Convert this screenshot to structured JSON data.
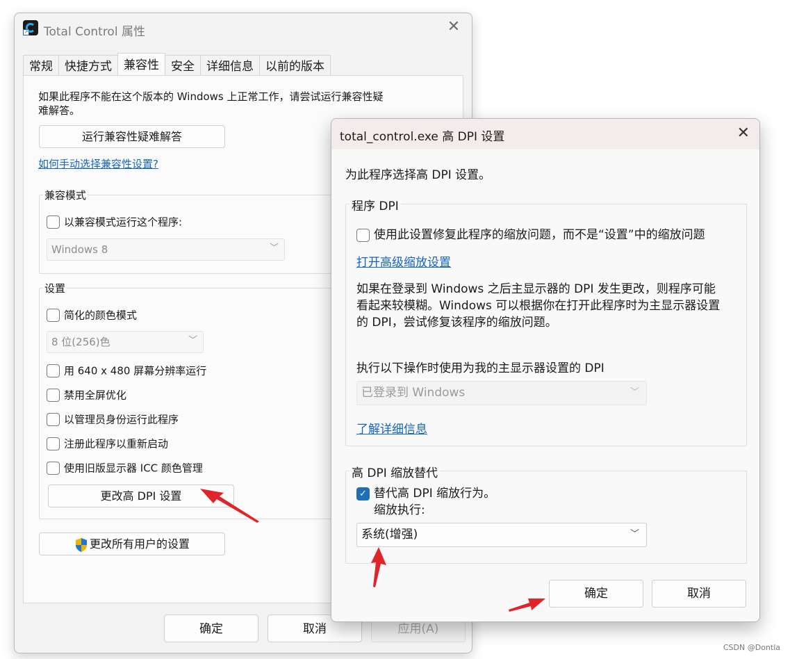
{
  "main_window": {
    "title": "Total Control 属性",
    "close_glyph": "✕",
    "tabs": [
      {
        "label": "常规",
        "active": false
      },
      {
        "label": "快捷方式",
        "active": false
      },
      {
        "label": "兼容性",
        "active": true
      },
      {
        "label": "安全",
        "active": false
      },
      {
        "label": "详细信息",
        "active": false
      },
      {
        "label": "以前的版本",
        "active": false
      }
    ],
    "intro_text": "如果此程序不能在这个版本的 Windows 上正常工作，请尝试运行兼容性疑难解答。",
    "troubleshoot_button": "运行兼容性疑难解答",
    "manual_link": "如何手动选择兼容性设置?",
    "compat_mode": {
      "label": "兼容模式",
      "checkbox": "以兼容模式运行这个程序:",
      "checked": false,
      "select_value": "Windows 8"
    },
    "settings": {
      "label": "设置",
      "reduced_color": {
        "label": "简化的颜色模式",
        "checked": false
      },
      "color_select_value": "8 位(256)色",
      "res_640": {
        "label": "用 640 x 480 屏幕分辨率运行",
        "checked": false
      },
      "disable_fullscreen": {
        "label": "禁用全屏优化",
        "checked": false
      },
      "run_as_admin": {
        "label": "以管理员身份运行此程序",
        "checked": false
      },
      "register_restart": {
        "label": "注册此程序以重新启动",
        "checked": false
      },
      "legacy_icc": {
        "label": "使用旧版显示器 ICC 颜色管理",
        "checked": false
      },
      "change_dpi_button": "更改高 DPI 设置"
    },
    "all_users_button": "更改所有用户的设置",
    "ok_button": "确定",
    "cancel_button": "取消",
    "apply_button": "应用(A)"
  },
  "dpi_dialog": {
    "title": "total_control.exe 高 DPI 设置",
    "close_glyph": "✕",
    "intro": "为此程序选择高 DPI 设置。",
    "program_dpi": {
      "label": "程序 DPI",
      "checkbox": "使用此设置修复此程序的缩放问题，而不是“设置”中的缩放问题",
      "checked": false,
      "advanced_link": "打开高级缩放设置",
      "description_lines": [
        "如果在登录到 Windows 之后主显示器的 DPI 发生更改，则程序可能",
        "看起来较模糊。Windows 可以根据你在打开此程序时为主显示器设置",
        "的 DPI，尝试修复该程序的缩放问题。"
      ],
      "use_dpi_label": "执行以下操作时使用为我的主显示器设置的 DPI",
      "use_dpi_select": "已登录到 Windows",
      "learn_more_link": "了解详细信息"
    },
    "override": {
      "label": "高 DPI 缩放替代",
      "checkbox": "替代高 DPI 缩放行为。",
      "checked": true,
      "sub_label": "缩放执行:",
      "select_value": "系统(增强)"
    },
    "ok_button": "确定",
    "cancel_button": "取消"
  },
  "watermark": "CSDN @Dontla",
  "colors": {
    "accent": "#1f6fb8",
    "link": "#1565c0",
    "annotation_arrow": "#e0242a"
  }
}
